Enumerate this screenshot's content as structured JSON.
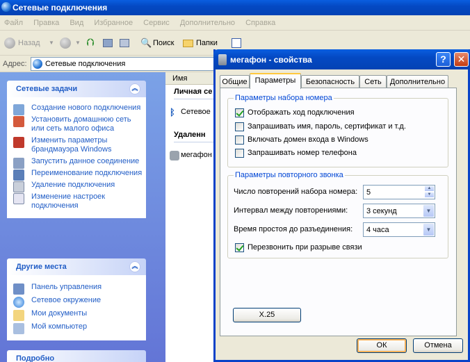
{
  "explorer": {
    "title": "Сетевые подключения",
    "menu": [
      "Файл",
      "Правка",
      "Вид",
      "Избранное",
      "Сервис",
      "Дополнительно",
      "Справка"
    ],
    "toolbar": {
      "back": "Назад",
      "search": "Поиск",
      "folders": "Папки"
    },
    "address": {
      "label": "Адрес:",
      "value": "Сетевые подключения"
    },
    "column_name": "Имя",
    "groups": {
      "personal": "Личная се",
      "remote": "Удаленн"
    },
    "items": {
      "bluetooth": "Сетевое",
      "megafon": "мегафон"
    }
  },
  "tasks_panel": {
    "title": "Сетевые задачи",
    "items": [
      "Создание нового подключения",
      "Установить домашнюю сеть или сеть малого офиса",
      "Изменить параметры брандмауэра Windows",
      "Запустить данное соединение",
      "Переименование подключения",
      "Удаление подключения",
      "Изменение настроек подключения"
    ]
  },
  "other_panel": {
    "title": "Другие места",
    "items": [
      "Панель управления",
      "Сетевое окружение",
      "Мои документы",
      "Мой компьютер"
    ]
  },
  "details_panel": {
    "title": "Подробно"
  },
  "dialog": {
    "title": "мегафон - свойства",
    "tabs": [
      "Общие",
      "Параметры",
      "Безопасность",
      "Сеть",
      "Дополнительно"
    ],
    "active_tab": "Параметры",
    "dial_group": {
      "legend": "Параметры набора номера",
      "checkboxes": [
        {
          "label": "Отображать ход подключения",
          "checked": true
        },
        {
          "label": "Запрашивать имя, пароль, сертификат и т.д.",
          "checked": false
        },
        {
          "label": "Включать домен входа в Windows",
          "checked": false
        },
        {
          "label": "Запрашивать номер телефона",
          "checked": false
        }
      ]
    },
    "redial_group": {
      "legend": "Параметры повторного звонка",
      "redial_attempts_label": "Число повторений набора номера:",
      "redial_attempts_value": "5",
      "interval_label": "Интервал между повторениями:",
      "interval_value": "3 секунд",
      "idle_label": "Время простоя до разъединения:",
      "idle_value": "4 часа",
      "redial_on_drop": {
        "label": "Перезвонить при разрыве связи",
        "checked": true
      }
    },
    "x25_button": "X.25",
    "ok_button": "ОК",
    "cancel_button": "Отмена"
  }
}
